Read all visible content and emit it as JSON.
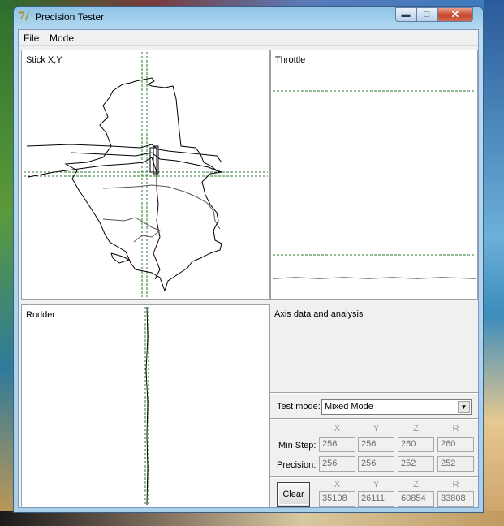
{
  "window": {
    "title": "Precision Tester",
    "app_icon": "7/",
    "accent": "#8ec3e6"
  },
  "menu": {
    "file": "File",
    "mode": "Mode"
  },
  "panels": {
    "stick": "Stick X,Y",
    "throttle": "Throttle",
    "rudder": "Rudder"
  },
  "analysis": {
    "title": "Axis data and analysis",
    "test_mode_label": "Test mode:",
    "test_mode_value": "Mixed Mode",
    "columns": [
      "X",
      "Y",
      "Z",
      "R"
    ],
    "min_step_label": "Min Step:",
    "min_step": [
      "256",
      "256",
      "260",
      "260"
    ],
    "precision_label": "Precision:",
    "precision": [
      "256",
      "256",
      "252",
      "252"
    ],
    "clear_label": "Clear",
    "raw": [
      "35108",
      "26111",
      "60854",
      "33808"
    ]
  },
  "icons": {
    "minimize": "minimize-icon",
    "maximize": "maximize-icon",
    "close": "close-icon",
    "dropdown": "chevron-down-icon"
  }
}
